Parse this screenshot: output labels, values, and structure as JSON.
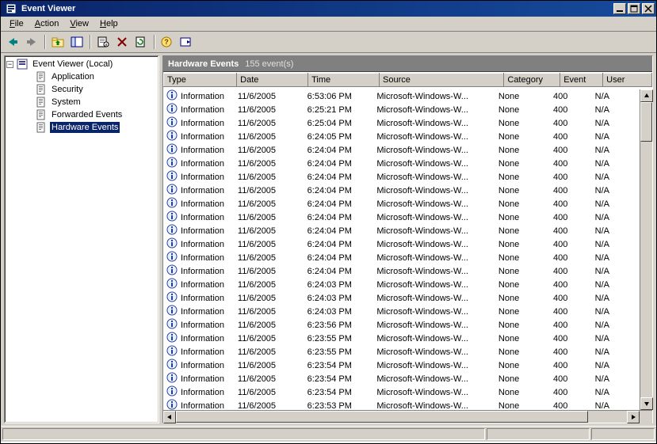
{
  "colors": {
    "accent": "#0a246a"
  },
  "window": {
    "title": "Event Viewer"
  },
  "menu": {
    "file": "File",
    "file_u": "F",
    "action": "Action",
    "action_u": "A",
    "view": "View",
    "view_u": "V",
    "help": "Help",
    "help_u": "H"
  },
  "tree": {
    "root": "Event Viewer (Local)",
    "items": [
      {
        "label": "Application"
      },
      {
        "label": "Security"
      },
      {
        "label": "System"
      },
      {
        "label": "Forwarded Events"
      },
      {
        "label": "Hardware Events",
        "selected": true
      }
    ]
  },
  "list": {
    "title": "Hardware Events",
    "count": "155 event(s)",
    "columns": {
      "type": "Type",
      "date": "Date",
      "time": "Time",
      "source": "Source",
      "category": "Category",
      "event": "Event",
      "user": "User"
    },
    "rows": [
      {
        "type": "Information",
        "date": "11/6/2005",
        "time": "6:53:06 PM",
        "source": "Microsoft-Windows-W...",
        "category": "None",
        "event": "400",
        "user": "N/A"
      },
      {
        "type": "Information",
        "date": "11/6/2005",
        "time": "6:25:21 PM",
        "source": "Microsoft-Windows-W...",
        "category": "None",
        "event": "400",
        "user": "N/A"
      },
      {
        "type": "Information",
        "date": "11/6/2005",
        "time": "6:25:04 PM",
        "source": "Microsoft-Windows-W...",
        "category": "None",
        "event": "400",
        "user": "N/A"
      },
      {
        "type": "Information",
        "date": "11/6/2005",
        "time": "6:24:05 PM",
        "source": "Microsoft-Windows-W...",
        "category": "None",
        "event": "400",
        "user": "N/A"
      },
      {
        "type": "Information",
        "date": "11/6/2005",
        "time": "6:24:04 PM",
        "source": "Microsoft-Windows-W...",
        "category": "None",
        "event": "400",
        "user": "N/A"
      },
      {
        "type": "Information",
        "date": "11/6/2005",
        "time": "6:24:04 PM",
        "source": "Microsoft-Windows-W...",
        "category": "None",
        "event": "400",
        "user": "N/A"
      },
      {
        "type": "Information",
        "date": "11/6/2005",
        "time": "6:24:04 PM",
        "source": "Microsoft-Windows-W...",
        "category": "None",
        "event": "400",
        "user": "N/A"
      },
      {
        "type": "Information",
        "date": "11/6/2005",
        "time": "6:24:04 PM",
        "source": "Microsoft-Windows-W...",
        "category": "None",
        "event": "400",
        "user": "N/A"
      },
      {
        "type": "Information",
        "date": "11/6/2005",
        "time": "6:24:04 PM",
        "source": "Microsoft-Windows-W...",
        "category": "None",
        "event": "400",
        "user": "N/A"
      },
      {
        "type": "Information",
        "date": "11/6/2005",
        "time": "6:24:04 PM",
        "source": "Microsoft-Windows-W...",
        "category": "None",
        "event": "400",
        "user": "N/A"
      },
      {
        "type": "Information",
        "date": "11/6/2005",
        "time": "6:24:04 PM",
        "source": "Microsoft-Windows-W...",
        "category": "None",
        "event": "400",
        "user": "N/A"
      },
      {
        "type": "Information",
        "date": "11/6/2005",
        "time": "6:24:04 PM",
        "source": "Microsoft-Windows-W...",
        "category": "None",
        "event": "400",
        "user": "N/A"
      },
      {
        "type": "Information",
        "date": "11/6/2005",
        "time": "6:24:04 PM",
        "source": "Microsoft-Windows-W...",
        "category": "None",
        "event": "400",
        "user": "N/A"
      },
      {
        "type": "Information",
        "date": "11/6/2005",
        "time": "6:24:04 PM",
        "source": "Microsoft-Windows-W...",
        "category": "None",
        "event": "400",
        "user": "N/A"
      },
      {
        "type": "Information",
        "date": "11/6/2005",
        "time": "6:24:03 PM",
        "source": "Microsoft-Windows-W...",
        "category": "None",
        "event": "400",
        "user": "N/A"
      },
      {
        "type": "Information",
        "date": "11/6/2005",
        "time": "6:24:03 PM",
        "source": "Microsoft-Windows-W...",
        "category": "None",
        "event": "400",
        "user": "N/A"
      },
      {
        "type": "Information",
        "date": "11/6/2005",
        "time": "6:24:03 PM",
        "source": "Microsoft-Windows-W...",
        "category": "None",
        "event": "400",
        "user": "N/A"
      },
      {
        "type": "Information",
        "date": "11/6/2005",
        "time": "6:23:56 PM",
        "source": "Microsoft-Windows-W...",
        "category": "None",
        "event": "400",
        "user": "N/A"
      },
      {
        "type": "Information",
        "date": "11/6/2005",
        "time": "6:23:55 PM",
        "source": "Microsoft-Windows-W...",
        "category": "None",
        "event": "400",
        "user": "N/A"
      },
      {
        "type": "Information",
        "date": "11/6/2005",
        "time": "6:23:55 PM",
        "source": "Microsoft-Windows-W...",
        "category": "None",
        "event": "400",
        "user": "N/A"
      },
      {
        "type": "Information",
        "date": "11/6/2005",
        "time": "6:23:54 PM",
        "source": "Microsoft-Windows-W...",
        "category": "None",
        "event": "400",
        "user": "N/A"
      },
      {
        "type": "Information",
        "date": "11/6/2005",
        "time": "6:23:54 PM",
        "source": "Microsoft-Windows-W...",
        "category": "None",
        "event": "400",
        "user": "N/A"
      },
      {
        "type": "Information",
        "date": "11/6/2005",
        "time": "6:23:54 PM",
        "source": "Microsoft-Windows-W...",
        "category": "None",
        "event": "400",
        "user": "N/A"
      },
      {
        "type": "Information",
        "date": "11/6/2005",
        "time": "6:23:53 PM",
        "source": "Microsoft-Windows-W...",
        "category": "None",
        "event": "400",
        "user": "N/A"
      }
    ]
  }
}
